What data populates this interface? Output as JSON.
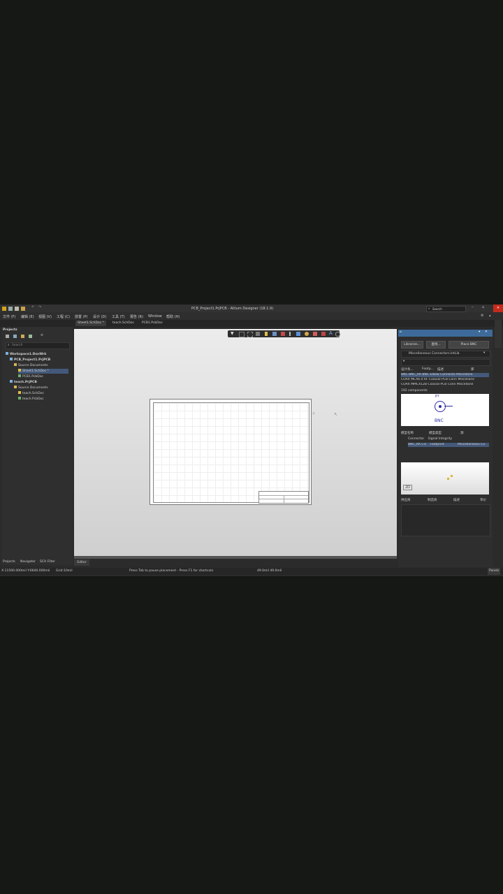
{
  "window": {
    "title": "PCB_Project1.PrjPCB - Altium Designer (18.1.9)",
    "search_label": "Search"
  },
  "menu": [
    "文件 (F)",
    "编辑 (E)",
    "视图 (V)",
    "工程 (C)",
    "放置 (P)",
    "设计 (D)",
    "工具 (T)",
    "报告 (R)",
    "Window",
    "帮助 (H)"
  ],
  "doc_tabs": [
    "Sheet1.SchDoc *",
    "teach.SchDoc",
    "PCB1.PcbDoc"
  ],
  "projects_panel": {
    "title": "Projects",
    "search_placeholder": "Search",
    "tree": [
      {
        "label": "Workspace1.DsnWrk",
        "indent": 0
      },
      {
        "label": "PCB_Project1.PrjPCB",
        "indent": 1
      },
      {
        "label": "Source Documents",
        "indent": 2
      },
      {
        "label": "Sheet1.SchDoc *",
        "indent": 3
      },
      {
        "label": "PCB1.PcbDoc",
        "indent": 3
      },
      {
        "label": "teach.PrjPCB",
        "indent": 1
      },
      {
        "label": "Source Documents",
        "indent": 2
      },
      {
        "label": "teach.SchDoc",
        "indent": 3
      },
      {
        "label": "teach.PcbDoc",
        "indent": 3
      }
    ],
    "bottom_tabs": [
      "Projects",
      "Navigator",
      "SCH Filter"
    ]
  },
  "editor_tab": "Editor",
  "libraries": {
    "buttons": [
      "Libraries...",
      "查找...",
      "Place BNC"
    ],
    "library_selected": "Miscellaneous Connectors.IntLib",
    "columns": [
      "设计条...",
      "Footp...",
      "描述",
      "库"
    ],
    "rows": [
      "BNC   BNC_RA BNC Elbow Connecto Miscellane",
      "COAX MCX6.0 RF Coaxial PCB Conn Miscellane",
      "COAX MMCX12B Coaxial PCB Conn Miscellane"
    ],
    "count_text": "192 components",
    "preview_designator": "P?",
    "preview_name": "BNC",
    "model_columns": [
      "模型名称",
      "模型类型",
      "源"
    ],
    "models": [
      {
        "name": "Connector",
        "type": "Signal Integrity",
        "source": ""
      },
      {
        "name": "BNC_RA CO",
        "type": "Footprint",
        "source": "Miscellaneous Co"
      }
    ],
    "view_mode": "2D",
    "supplier_columns": [
      "供应商",
      "制造商",
      "描述",
      "单价"
    ]
  },
  "status": {
    "coords": "X:11500.000mil Y:6640.000mil",
    "grid": "Grid:10mil",
    "message": "Press Tab to pause placement - Press F1 for shortcuts",
    "dims": "49.0mil 49.0mil",
    "panels": "Panels"
  },
  "colors": {
    "accent": "#2f6db0",
    "title_bg": "#323232",
    "panel_bg": "#2e2e2e",
    "close": "#c42b1c"
  }
}
